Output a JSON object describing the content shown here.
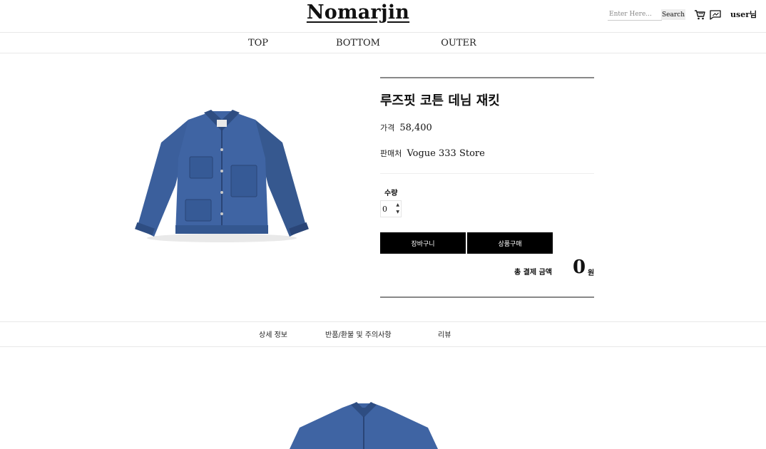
{
  "header": {
    "logo": "Nomarjin",
    "search_placeholder": "Enter Here...",
    "search_button": "Search",
    "user_label": "user님"
  },
  "nav": {
    "items": [
      "TOP",
      "BOTTOM",
      "OUTER"
    ]
  },
  "product": {
    "title": "루즈핏 코튼 데님 재킷",
    "price_label": "가격",
    "price": "58,400",
    "seller_label": "판매처",
    "seller": "Vogue 333 Store",
    "quantity_label": "수량",
    "quantity": "0",
    "cart_button": "장바구니",
    "buy_button": "상품구매",
    "total_label": "총 결제 금액",
    "total_value": "0",
    "total_unit": "원"
  },
  "tabs": [
    "상세 정보",
    "반품/환불 및 주의사항",
    "리뷰"
  ],
  "colors": {
    "button_bg": "#000000",
    "denim": "#3b5f9c"
  },
  "icons": [
    "cart-icon",
    "message-icon",
    "spinner-up-icon",
    "spinner-down-icon"
  ]
}
